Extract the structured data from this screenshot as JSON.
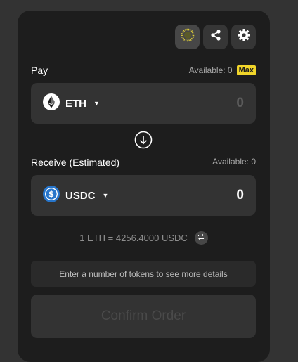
{
  "toolbar": {
    "icons": [
      "sun-theme-icon",
      "share-icon",
      "gear-icon"
    ]
  },
  "pay": {
    "label": "Pay",
    "available": "Available: 0",
    "max_label": "Max",
    "token": "ETH",
    "amount": "0"
  },
  "receive": {
    "label": "Receive (Estimated)",
    "available": "Available: 0",
    "token": "USDC",
    "amount": "0"
  },
  "rate": {
    "text": "1 ETH = 4256.4000 USDC"
  },
  "info": {
    "text": "Enter a number of tokens to see more details"
  },
  "confirm": {
    "label": "Confirm Order"
  },
  "colors": {
    "accent": "#f1d52a",
    "panel": "#1d1d1d",
    "field": "#333333",
    "usdc": "#2775ca"
  }
}
